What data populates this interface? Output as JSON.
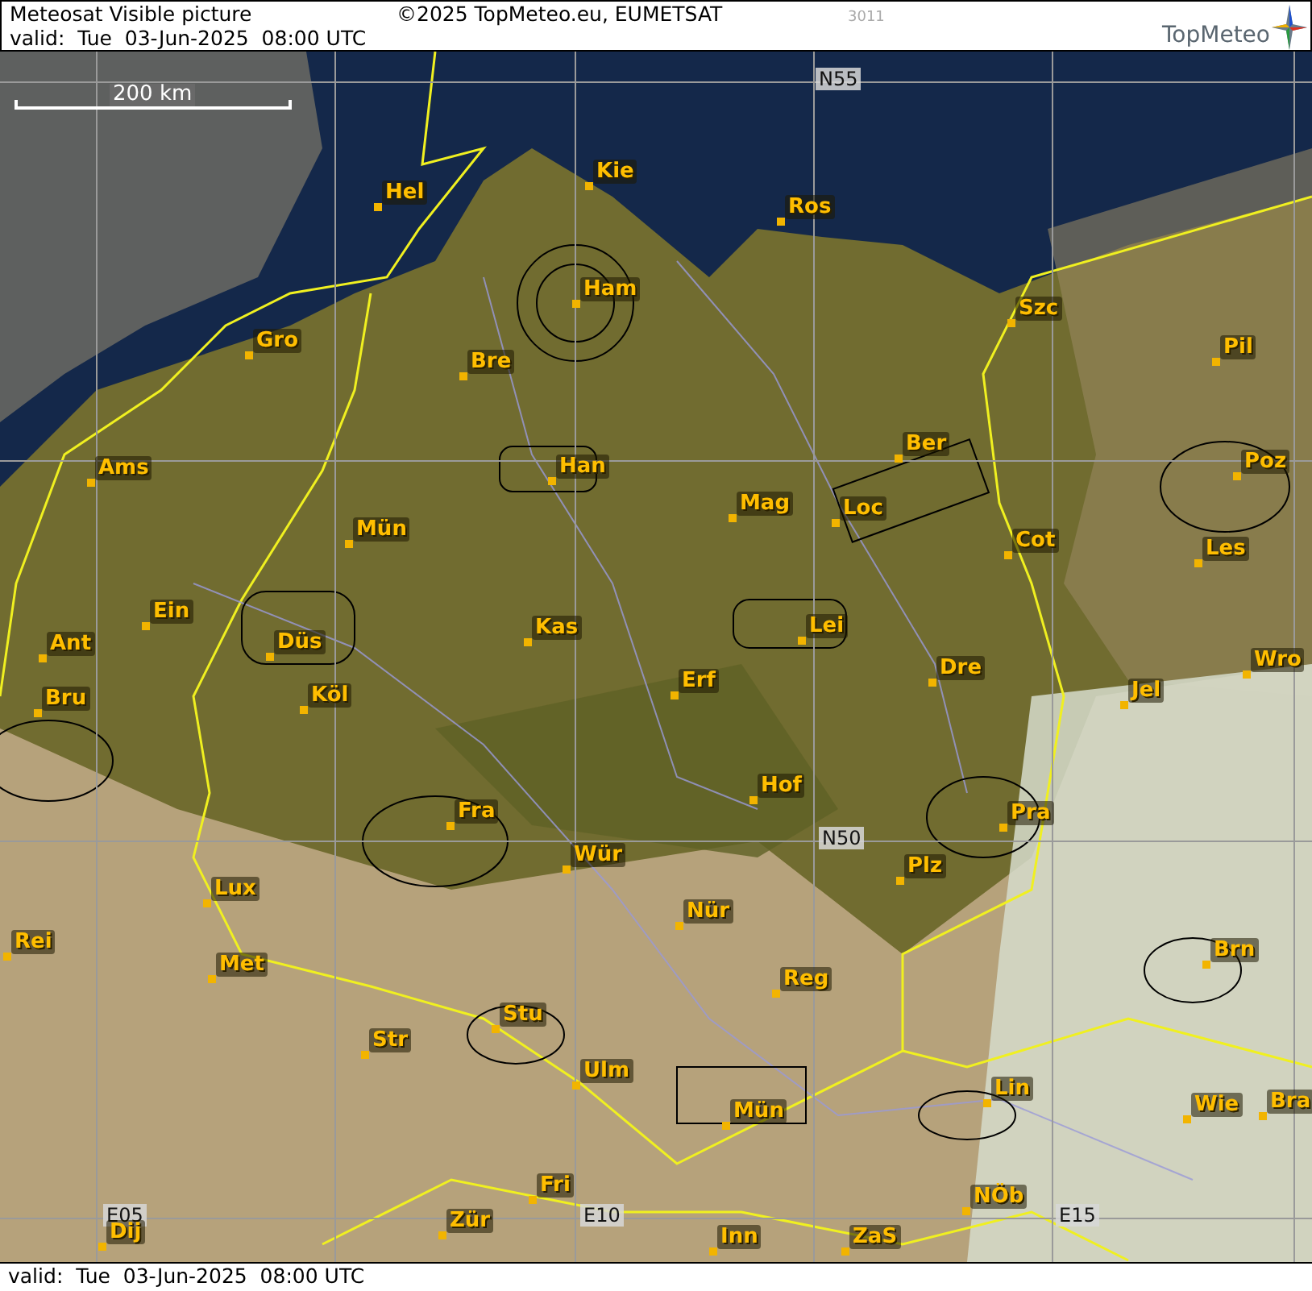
{
  "header": {
    "title": "Meteosat Visible picture",
    "valid": "valid:  Tue  03-Jun-2025  08:00 UTC",
    "copyright": "©2025 TopMeteo.eu, EUMETSAT",
    "code": "3011",
    "logo": "TopMeteo"
  },
  "map": {
    "scale": "200 km",
    "grid_labels": [
      "N55",
      "N50",
      "E05",
      "E10",
      "E15"
    ],
    "cities": [
      {
        "name": "Hel"
      },
      {
        "name": "Kie"
      },
      {
        "name": "Ros"
      },
      {
        "name": "Ham"
      },
      {
        "name": "Gro"
      },
      {
        "name": "Bre"
      },
      {
        "name": "Szc"
      },
      {
        "name": "Pil"
      },
      {
        "name": "Ams"
      },
      {
        "name": "Ber"
      },
      {
        "name": "Han"
      },
      {
        "name": "Mag"
      },
      {
        "name": "Loc"
      },
      {
        "name": "Poz"
      },
      {
        "name": "Mün"
      },
      {
        "name": "Cot"
      },
      {
        "name": "Les"
      },
      {
        "name": "Ein"
      },
      {
        "name": "Kas"
      },
      {
        "name": "Lei"
      },
      {
        "name": "Ant"
      },
      {
        "name": "Düs"
      },
      {
        "name": "Wro"
      },
      {
        "name": "Dre"
      },
      {
        "name": "Bru"
      },
      {
        "name": "Köl"
      },
      {
        "name": "Erf"
      },
      {
        "name": "Jel"
      },
      {
        "name": "Hof"
      },
      {
        "name": "Fra"
      },
      {
        "name": "Pra"
      },
      {
        "name": "Wür"
      },
      {
        "name": "Plz"
      },
      {
        "name": "Lux"
      },
      {
        "name": "Nür"
      },
      {
        "name": "Rei"
      },
      {
        "name": "Brn"
      },
      {
        "name": "Met"
      },
      {
        "name": "Reg"
      },
      {
        "name": "Stu"
      },
      {
        "name": "Str"
      },
      {
        "name": "Lin"
      },
      {
        "name": "Ulm"
      },
      {
        "name": "Mün"
      },
      {
        "name": "Wie"
      },
      {
        "name": "Bra"
      },
      {
        "name": "Fri"
      },
      {
        "name": "Zür"
      },
      {
        "name": "NÖb"
      },
      {
        "name": "Dij"
      },
      {
        "name": "Inn"
      },
      {
        "name": "ZaS"
      }
    ]
  },
  "footer": {
    "valid": "valid:  Tue  03-Jun-2025  08:00 UTC"
  }
}
